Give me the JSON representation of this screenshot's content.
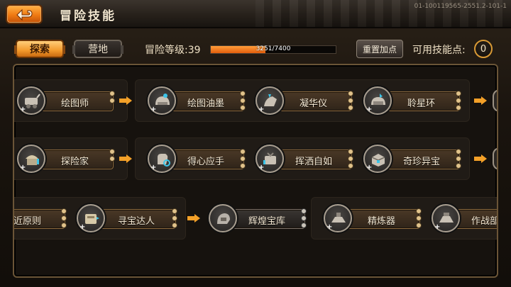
{
  "header": {
    "title": "冒险技能",
    "build_id": "01-100119565-2551.2-101-1"
  },
  "tabs": [
    {
      "label": "探索",
      "active": true
    },
    {
      "label": "营地",
      "active": false
    }
  ],
  "level": {
    "label": "冒险等级:39",
    "xp_text": "3251/7400",
    "progress": 0.44
  },
  "reset_label": "重置加点",
  "skill_points": {
    "label": "可用技能点:",
    "value": "0"
  },
  "rows": [
    {
      "nodes": [
        {
          "label": "绘图师",
          "icon": "cartographer-cart-icon"
        },
        {
          "label": "绘图油墨",
          "icon": "ink-helmet-icon"
        },
        {
          "label": "凝华仪",
          "icon": "condenser-icon"
        },
        {
          "label": "聆星环",
          "icon": "star-ring-helmet-icon"
        }
      ]
    },
    {
      "nodes": [
        {
          "label": "探险家",
          "icon": "explorer-icon"
        },
        {
          "label": "得心应手",
          "icon": "hand-skill-icon"
        },
        {
          "label": "挥洒自如",
          "icon": "ease-icon"
        },
        {
          "label": "奇珍异宝",
          "icon": "treasure-chest-icon"
        }
      ]
    },
    {
      "nodes": [
        {
          "label": "就近原则",
          "icon": "proximity-icon"
        },
        {
          "label": "寻宝达人",
          "icon": "treasure-hunter-icon"
        },
        {
          "label": "辉煌宝库",
          "icon": "glorious-vault-icon"
        },
        {
          "label": "精炼器",
          "icon": "refiner-icon"
        },
        {
          "label": "作战部",
          "icon": "combat-dept-icon"
        }
      ]
    }
  ],
  "colors": {
    "accent_orange": "#f39a2c",
    "xp_fill": "#e35e0c",
    "panel_border": "#6b5537"
  }
}
